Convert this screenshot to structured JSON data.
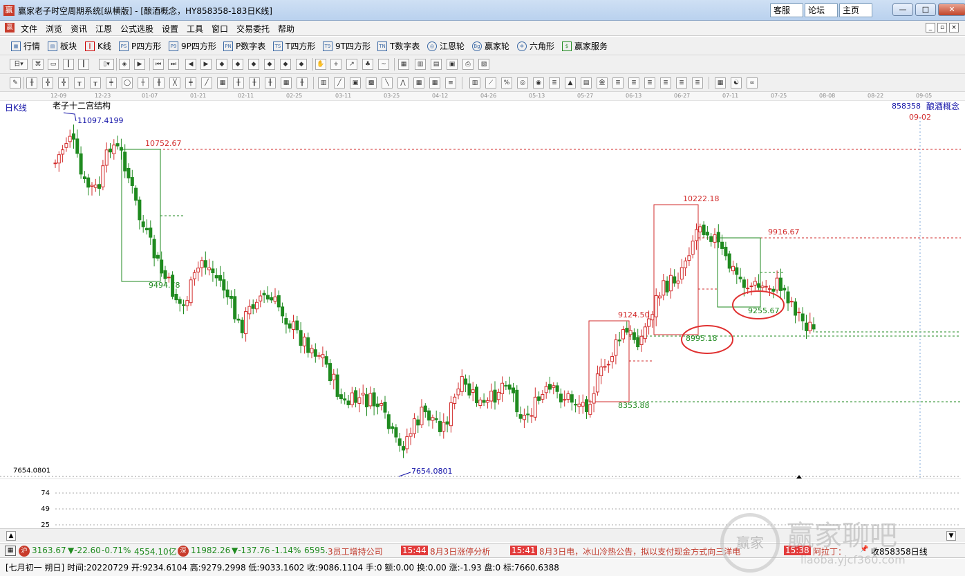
{
  "window": {
    "app_icon": "赢",
    "title": "赢家老子时空周期系统[纵横版] - [酿酒概念，HY858358-183日K线]",
    "links": [
      "客服",
      "论坛",
      "主页"
    ],
    "buttons": [
      "—",
      "□",
      "✕"
    ]
  },
  "menu": {
    "items": [
      "文件",
      "浏览",
      "资讯",
      "江恩",
      "公式选股",
      "设置",
      "工具",
      "窗口",
      "交易委托",
      "帮助"
    ],
    "mdi_buttons": [
      "_",
      "▫",
      "×"
    ]
  },
  "toolbar1": [
    {
      "label": "行情",
      "icon": "table-icon"
    },
    {
      "label": "板块",
      "icon": "blocks-icon"
    },
    {
      "label": "K线",
      "icon": "candles-icon"
    },
    {
      "label": "P四方形",
      "icon": "ps-icon",
      "badge": "PS"
    },
    {
      "label": "9P四方形",
      "icon": "p9-icon",
      "badge": "P9"
    },
    {
      "label": "P数字表",
      "icon": "pn-icon",
      "badge": "PN"
    },
    {
      "label": "T四方形",
      "icon": "ts-icon",
      "badge": "TS"
    },
    {
      "label": "9T四方形",
      "icon": "t9-icon",
      "badge": "T9"
    },
    {
      "label": "T数字表",
      "icon": "tn-icon",
      "badge": "TN"
    },
    {
      "label": "江恩轮",
      "icon": "gann-wheel-icon",
      "badge": "◎"
    },
    {
      "label": "赢家轮",
      "icon": "winner-wheel-icon",
      "badge": "Bg"
    },
    {
      "label": "六角形",
      "icon": "hexagon-icon",
      "badge": "✡"
    },
    {
      "label": "赢家服务",
      "icon": "dollar-icon",
      "badge": "$"
    }
  ],
  "chart": {
    "period_label": "日K线",
    "indicator_name": "老子十二宫结构",
    "symbol_code": "858358",
    "symbol_name": "酿酒概念",
    "cursor_date": "09-02",
    "high_label": "11097.4199",
    "low_label": "7654.0801",
    "axis_low_label": "7654.0801",
    "levels": [
      "10752.67",
      "9494.78",
      "10222.18",
      "9916.67",
      "9255.67",
      "9124.50",
      "8995.18",
      "8353.88"
    ],
    "volume_axis": [
      "74",
      "49",
      "25"
    ],
    "dates": [
      "12-09",
      "12-23",
      "01-07",
      "01-21",
      "02-11",
      "02-25",
      "03-11",
      "03-25",
      "04-12",
      "04-26",
      "05-13",
      "05-27",
      "06-13",
      "06-27",
      "07-11",
      "07-25",
      "08-08",
      "08-22",
      "09-05"
    ],
    "colors": {
      "up": "#d22b2b",
      "down": "#1f8a1f",
      "level_red": "#d22b2b",
      "level_green": "#1f8a1f",
      "extreme": "#1414a8"
    }
  },
  "ticker": {
    "idx1_value": "3163.67",
    "idx1_change": "▼-22.60",
    "idx1_pct": "-0.71%",
    "idx1_amount": "4554.10亿",
    "idx2_value": "11982.26",
    "idx2_change": "▼-137.76",
    "idx2_pct": "-1.14%",
    "idx2_amount": "6595.",
    "news0_text": "3员工增持公司",
    "news1_time": "15:44",
    "news1_text": "8月3日涨停分析",
    "news2_time": "15:41",
    "news2_text": "8月3日电，冰山冷热公告，拟以支付现金方式向三洋电",
    "news3_time": "15:38",
    "news3_text": "阿拉丁：",
    "right_text": "收858358日线"
  },
  "info_bar": "[七月初一  朔日] 时间:20220729 开:9234.6104 高:9279.2998 低:9033.1602 收:9086.1104 手:0 额:0.00 换:0.00 涨:-1.93 盘:0 标:7660.6388",
  "watermark": {
    "seal": "赢家",
    "title": "赢家聊吧",
    "url": "liaoba.yjcf360.com"
  }
}
